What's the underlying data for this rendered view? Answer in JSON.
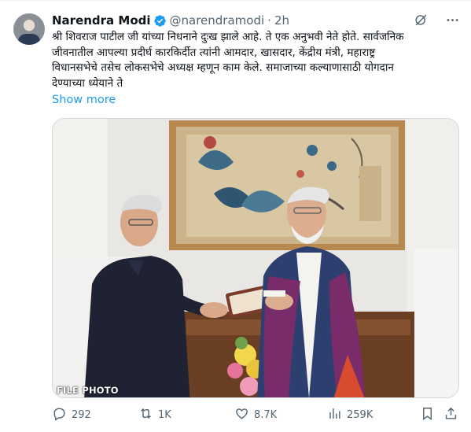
{
  "author": {
    "name": "Narendra Modi",
    "handle": "@narendramodi",
    "separator": "·",
    "time": "2h",
    "verified_icon": "verified-badge-icon"
  },
  "tweet": {
    "text": "श्री शिवराज पाटील जी यांच्या निधनाने दुःख झाले आहे. ते एक अनुभवी नेते होते. सार्वजनिक\nजीवनातील आपल्या प्रदीर्घ कारकिर्दीत त्यांनी आमदार, खासदार, केंद्रीय मंत्री, महाराष्ट्र\nविधानसभेचे तसेच लोकसभेचे अध्यक्ष म्हणून काम केले. समाजाच्या कल्याणासाठी योगदान\nदेण्याच्या ध्येयाने ते",
    "show_more": "Show more"
  },
  "media": {
    "overlay_label": "FILE PHOTO"
  },
  "actions": {
    "replies": "292",
    "reposts": "1K",
    "likes": "8.7K",
    "views": "259K"
  },
  "icons": {
    "grok": "grok-icon",
    "more": "more-icon",
    "reply": "reply-icon",
    "repost": "repost-icon",
    "like": "heart-icon",
    "views": "views-icon",
    "bookmark": "bookmark-icon",
    "share": "share-icon"
  },
  "colors": {
    "accent": "#1d9bf0",
    "muted": "#536471",
    "text": "#0f1419"
  }
}
